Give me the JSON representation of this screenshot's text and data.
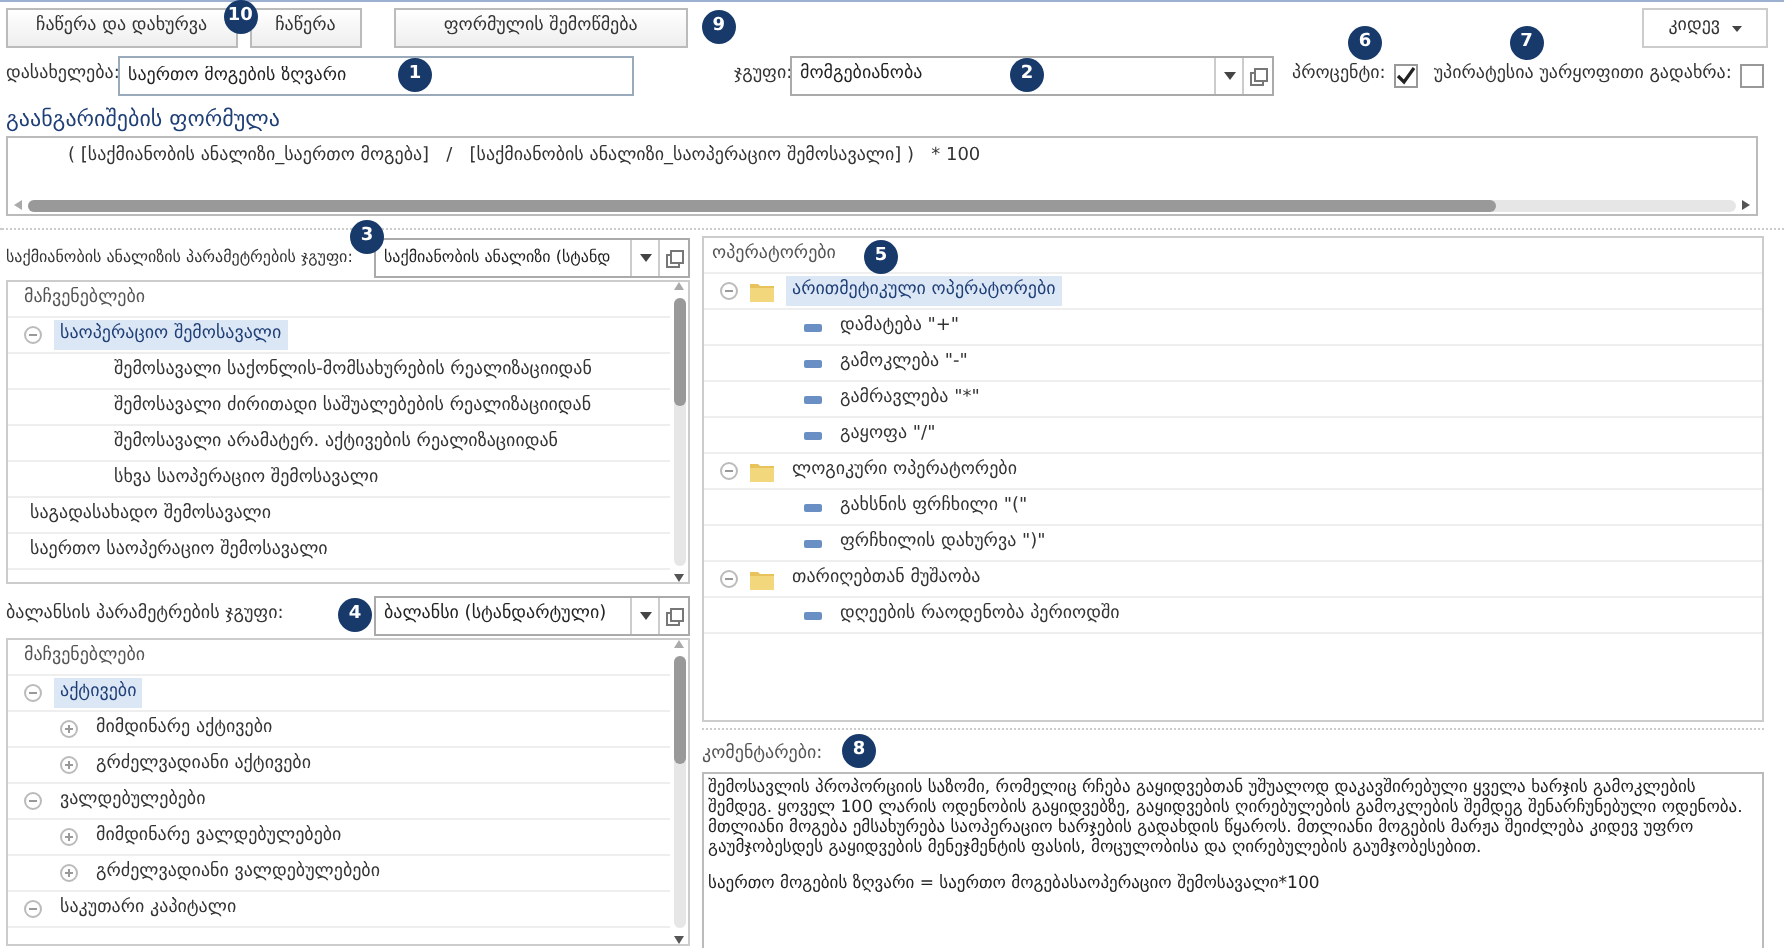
{
  "toolbar": {
    "buttons": [
      {
        "label": "ჩაწერა და დახურვა",
        "callout": "10"
      },
      {
        "label": "ჩაწერა"
      },
      {
        "label": "ფორმულის შემოწმება",
        "callout": "9"
      }
    ],
    "more_button": "კიდევ"
  },
  "name_field": {
    "label": "დასახელება:",
    "value": "საერთო მოგების ზღვარი",
    "callout": "1"
  },
  "group_field": {
    "label": "ჯგუფი:",
    "value": "მომგებიანობა",
    "callout": "2"
  },
  "percent": {
    "label": "პროცენტი:",
    "checked": true,
    "callout": "6"
  },
  "negative_preferred": {
    "label": "უპირატესია უარყოფითი გადახრა:",
    "checked": false,
    "callout": "7"
  },
  "formula": {
    "title": "გაანგარიშების ფორმულა",
    "text": "( [საქმიანობის ანალიზი_საერთო მოგება]   /   [საქმიანობის ანალიზი_საოპერაციო შემოსავალი] )   * 100"
  },
  "activity_params": {
    "label": "საქმიანობის ანალიზის პარამეტრების ჯგუფი:",
    "value": "საქმიანობის ანალიზი (სტანდ",
    "callout": "3",
    "header": "მაჩვენებლები",
    "items": [
      {
        "label": "საოპერაციო შემოსავალი",
        "expanded": true,
        "selected": true,
        "children": [
          {
            "label": "შემოსავალი საქონლის-მომსახურების რეალიზაციიდან",
            "selected": false
          },
          {
            "label": "შემოსავალი ძირითადი საშუალებების რეალიზაციიდან",
            "selected": false
          },
          {
            "label": "შემოსავალი არამატერ. აქტივების რეალიზაციიდან",
            "selected": false
          },
          {
            "label": "სხვა საოპერაციო შემოსავალი",
            "selected": false
          }
        ]
      },
      {
        "label": "საგადასახადო შემოსავალი",
        "selected": false
      },
      {
        "label": "საერთო საოპერაციო შემოსავალი",
        "selected": false
      }
    ]
  },
  "balance_params": {
    "label": "ბალანსის პარამეტრების ჯგუფი:",
    "value": "ბალანსი (სტანდარტული)",
    "callout": "4",
    "header": "მაჩვენებლები",
    "items": [
      {
        "label": "აქტივები",
        "expanded": true,
        "selected": true,
        "children": [
          {
            "label": "მიმდინარე აქტივები",
            "has_children": true,
            "expanded": false,
            "selected": false
          },
          {
            "label": "გრძელვადიანი აქტივები",
            "has_children": true,
            "expanded": false,
            "selected": false
          }
        ]
      },
      {
        "label": "ვალდებულებები",
        "expanded": true,
        "selected": false,
        "children": [
          {
            "label": "მიმდინარე ვალდებულებები",
            "has_children": true,
            "expanded": false,
            "selected": false
          },
          {
            "label": "გრძელვადიანი ვალდებულებები",
            "has_children": true,
            "expanded": false,
            "selected": false
          }
        ]
      },
      {
        "label": "საკუთარი კაპიტალი",
        "has_children": true,
        "expanded": true,
        "selected": false
      }
    ]
  },
  "operators": {
    "title": "ოპერატორები",
    "callout": "5",
    "items": [
      {
        "kind": "folder",
        "label": "არითმეტიკული ოპერატორები",
        "expanded": true,
        "selected": true,
        "children": [
          {
            "kind": "operator",
            "label": "დამატება \"+\"",
            "selected": false
          },
          {
            "kind": "operator",
            "label": "გამოკლება \"-\"",
            "selected": false
          },
          {
            "kind": "operator",
            "label": "გამრავლება \"*\"",
            "selected": false
          },
          {
            "kind": "operator",
            "label": "გაყოფა \"/\"",
            "selected": false
          }
        ]
      },
      {
        "kind": "folder",
        "label": "ლოგიკური ოპერატორები",
        "expanded": true,
        "selected": false,
        "children": [
          {
            "kind": "operator",
            "label": "გახსნის ფრჩხილი \"(\"",
            "selected": false
          },
          {
            "kind": "operator",
            "label": "ფრჩხილის დახურვა \")\"",
            "selected": false
          }
        ]
      },
      {
        "kind": "folder",
        "label": "თარიღებთან მუშაობა",
        "expanded": true,
        "selected": false,
        "children": [
          {
            "kind": "operator",
            "label": "დღეების რაოდენობა პერიოდში",
            "selected": false
          }
        ]
      }
    ]
  },
  "comments": {
    "label": "კომენტარები:",
    "callout": "8",
    "paragraphs": [
      "შემოსავლის პროპორციის საზომი, რომელიც რჩება გაყიდვებთან უშუალოდ დაკავშირებული ყველა ხარჯის გამოკლების შემდეგ. ყოველ 100 ლარის ოდენობის გაყიდვებზე, გაყიდვების ღირებულების გამოკლების შემდეგ შენარჩუნებული ოდენობა. მთლიანი მოგება ემსახურება საოპერაციო ხარჯების გადახდის წყაროს. მთლიანი მოგების მარჟა შეიძლება კიდევ უფრო გაუმჯობესდეს გაყიდვების მენეჯმენტის ფასის, მოცულობისა და ღირებულების გაუმჯობესებით.",
      "საერთო მოგების ზღვარი = საერთო მოგებასაოპერაციო შემოსავალი*100"
    ]
  }
}
